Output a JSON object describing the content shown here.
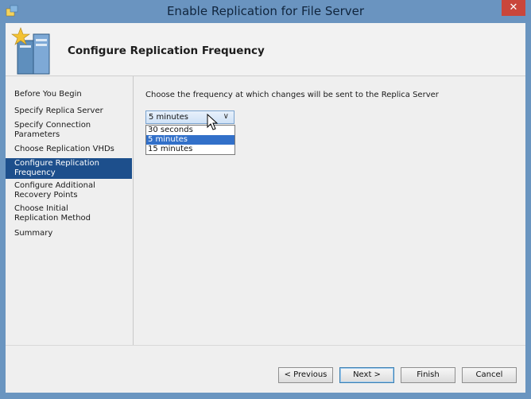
{
  "window": {
    "title": "Enable Replication for File Server",
    "close_label": "✕"
  },
  "header": {
    "title": "Configure Replication Frequency"
  },
  "nav": {
    "items": [
      {
        "label": "Before You Begin"
      },
      {
        "label": "Specify Replica Server"
      },
      {
        "label": "Specify Connection Parameters"
      },
      {
        "label": "Choose Replication VHDs"
      },
      {
        "label": "Configure Replication Frequency"
      },
      {
        "label": "Configure Additional Recovery Points"
      },
      {
        "label": "Choose Initial Replication Method"
      },
      {
        "label": "Summary"
      }
    ]
  },
  "content": {
    "prompt": "Choose the frequency at which changes will be sent to the Replica Server",
    "frequency_select": {
      "selected": "5 minutes",
      "options": [
        "30 seconds",
        "5 minutes",
        "15 minutes"
      ]
    }
  },
  "buttons": {
    "previous": "< Previous",
    "next": "Next >",
    "finish": "Finish",
    "cancel": "Cancel"
  }
}
